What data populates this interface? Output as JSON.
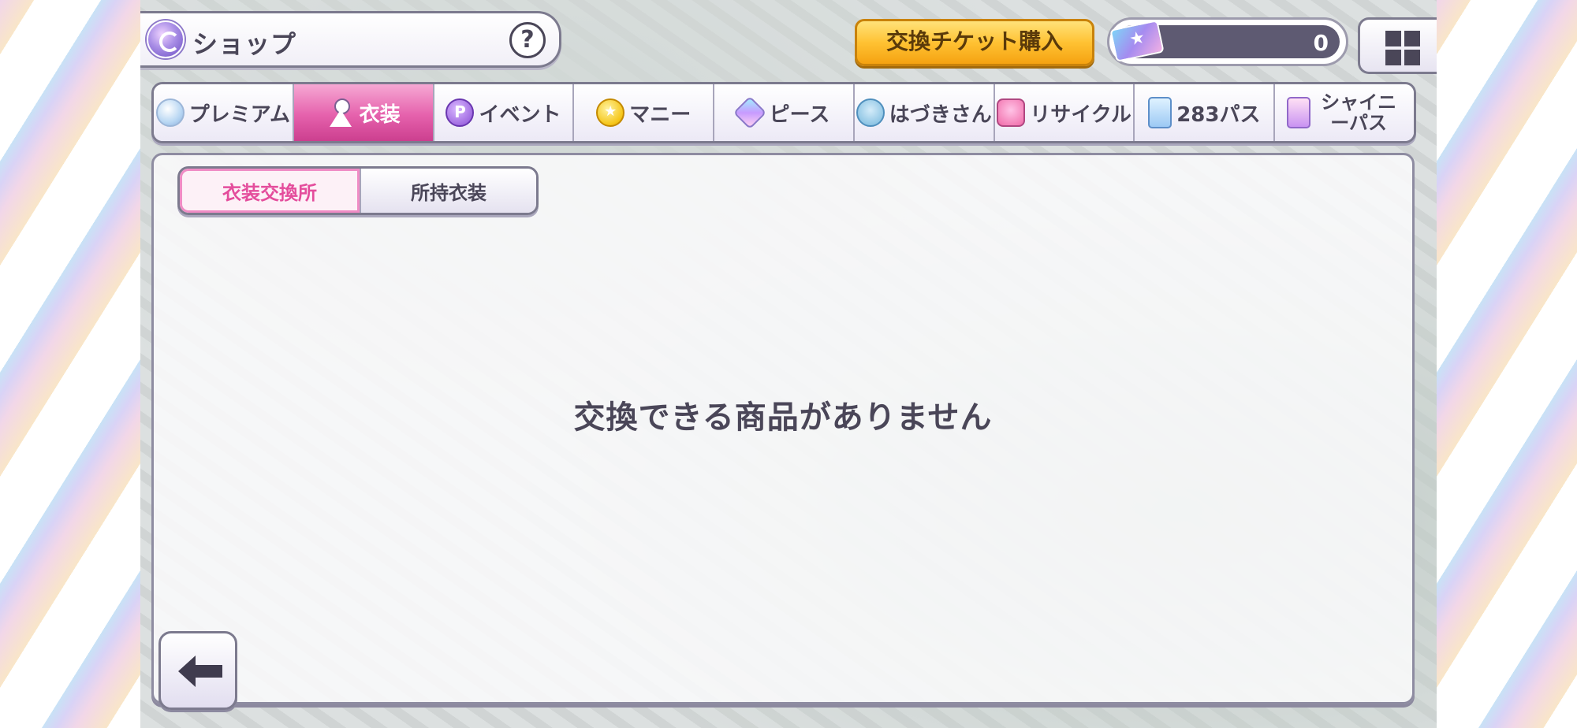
{
  "header": {
    "title": "ショップ",
    "help_label": "?",
    "icon": "shop-icon"
  },
  "ticket": {
    "buy_label": "交換チケット購入",
    "count": "0",
    "icon": "ticket-icon"
  },
  "menu": {
    "icon": "grid-menu-icon"
  },
  "tabs": [
    {
      "label": "プレミアム",
      "icon": "premium-gem-icon",
      "active": false
    },
    {
      "label": "衣装",
      "icon": "costume-icon",
      "active": true
    },
    {
      "label": "イベント",
      "icon": "event-coin-icon",
      "active": false
    },
    {
      "label": "マニー",
      "icon": "money-coin-icon",
      "active": false
    },
    {
      "label": "ピース",
      "icon": "piece-icon",
      "active": false
    },
    {
      "label": "はづきさん",
      "icon": "hazuki-icon",
      "active": false
    },
    {
      "label": "リサイクル",
      "icon": "recycle-icon",
      "active": false
    },
    {
      "label": "283パス",
      "icon": "pass-283-icon",
      "active": false
    },
    {
      "label": "シャイニーパス",
      "icon": "shiny-pass-icon",
      "active": false
    }
  ],
  "sub_tabs": [
    {
      "label": "衣装交換所",
      "active": true
    },
    {
      "label": "所持衣装",
      "active": false
    }
  ],
  "main": {
    "empty_message": "交換できる商品がありません"
  },
  "back": {
    "icon": "back-arrow-icon"
  },
  "colors": {
    "active_tab": "#e561ac",
    "ticket_button": "#ffc233",
    "text": "#4a4658",
    "sub_tab_active_text": "#e44d9c"
  }
}
